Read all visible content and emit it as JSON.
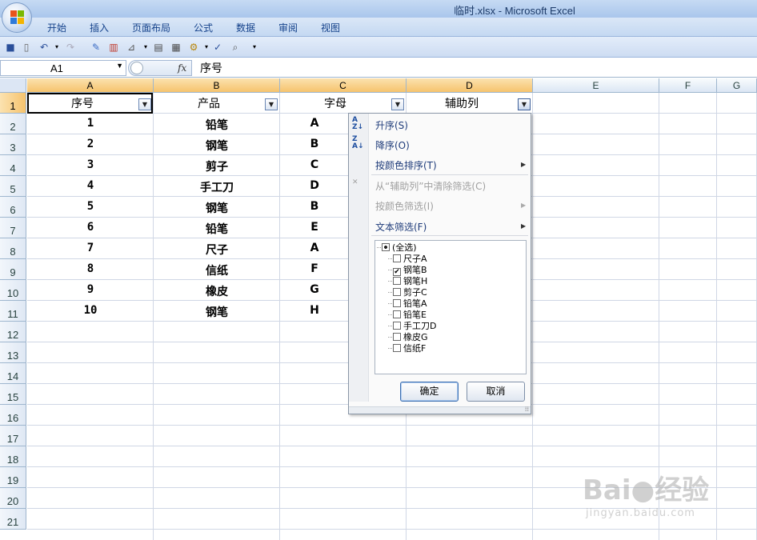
{
  "window": {
    "title": "临时.xlsx - Microsoft Excel"
  },
  "ribbon_tabs": [
    "开始",
    "插入",
    "页面布局",
    "公式",
    "数据",
    "审阅",
    "视图"
  ],
  "name_box": {
    "value": "A1"
  },
  "formula_bar": {
    "fx_label": "fx",
    "value": "序号"
  },
  "columns": [
    "A",
    "B",
    "C",
    "D",
    "E",
    "F",
    "G"
  ],
  "rows": [
    "1",
    "2",
    "3",
    "4",
    "5",
    "6",
    "7",
    "8",
    "9",
    "10",
    "11",
    "12",
    "13",
    "14",
    "15",
    "16",
    "17",
    "18",
    "19",
    "20",
    "21"
  ],
  "header_row": [
    "序号",
    "产品",
    "字母",
    "辅助列"
  ],
  "data_rows": [
    [
      "1",
      "铅笔",
      "A"
    ],
    [
      "2",
      "钢笔",
      "B"
    ],
    [
      "3",
      "剪子",
      "C"
    ],
    [
      "4",
      "手工刀",
      "D"
    ],
    [
      "5",
      "钢笔",
      "B"
    ],
    [
      "6",
      "铅笔",
      "E"
    ],
    [
      "7",
      "尺子",
      "A"
    ],
    [
      "8",
      "信纸",
      "F"
    ],
    [
      "9",
      "橡皮",
      "G"
    ],
    [
      "10",
      "钢笔",
      "H"
    ]
  ],
  "filter_menu": {
    "sort_asc": "升序(S)",
    "sort_desc": "降序(O)",
    "sort_by_color": "按颜色排序(T)",
    "clear_filter": "从“辅助列”中清除筛选(C)",
    "filter_by_color": "按颜色筛选(I)",
    "text_filter": "文本筛选(F)",
    "list": [
      {
        "label": "(全选)",
        "state": "mixed"
      },
      {
        "label": "尺子A",
        "state": "unchecked"
      },
      {
        "label": "钢笔B",
        "state": "checked"
      },
      {
        "label": "钢笔H",
        "state": "unchecked"
      },
      {
        "label": "剪子C",
        "state": "unchecked"
      },
      {
        "label": "铅笔A",
        "state": "unchecked"
      },
      {
        "label": "铅笔E",
        "state": "unchecked"
      },
      {
        "label": "手工刀D",
        "state": "unchecked"
      },
      {
        "label": "橡皮G",
        "state": "unchecked"
      },
      {
        "label": "信纸F",
        "state": "unchecked"
      }
    ],
    "ok": "确定",
    "cancel": "取消"
  },
  "watermark": {
    "brand": "Bai",
    "brand2": "经验",
    "url": "jingyan.baidu.com"
  },
  "colors": {
    "selected_header": "#f6c36d",
    "menu_text": "#1f3c7a",
    "gridline": "#d0d7e5"
  }
}
